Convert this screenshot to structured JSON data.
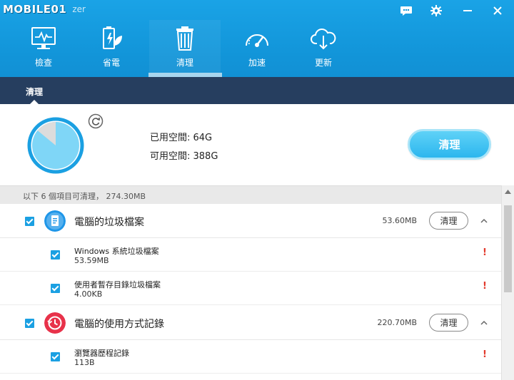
{
  "app": {
    "brand_logo": "MOBILE01",
    "brand_suffix": "zer"
  },
  "nav": {
    "items": [
      {
        "label": "檢查",
        "icon": "monitor-pulse-icon"
      },
      {
        "label": "省電",
        "icon": "battery-leaf-icon"
      },
      {
        "label": "清理",
        "icon": "trash-icon",
        "active": true
      },
      {
        "label": "加速",
        "icon": "speedometer-icon"
      },
      {
        "label": "更新",
        "icon": "cloud-download-icon"
      }
    ]
  },
  "subbar": {
    "tab": "清理"
  },
  "summary": {
    "used_label": "已用空間: 64G",
    "free_label": "可用空間: 388G",
    "used_fraction": 0.14,
    "clean_button": "清理"
  },
  "info": {
    "text": "以下 6 個項目可清理， 274.30MB"
  },
  "groups": [
    {
      "title": "電腦的垃圾檔案",
      "size": "53.60MB",
      "clean_label": "清理",
      "icon": "document-icon",
      "icon_color": "#1e96e8",
      "items": [
        {
          "name": "Windows 系統垃圾檔案",
          "size": "53.59MB",
          "warn": "!"
        },
        {
          "name": "使用者暫存目錄垃圾檔案",
          "size": "4.00KB",
          "warn": "!"
        }
      ]
    },
    {
      "title": "電腦的使用方式記錄",
      "size": "220.70MB",
      "clean_label": "清理",
      "icon": "history-clock-icon",
      "icon_color": "#e8324a",
      "items": [
        {
          "name": "瀏覽器歷程記錄",
          "size": "113B",
          "warn": "!"
        }
      ]
    }
  ],
  "colors": {
    "header": "#1397db",
    "subbar": "#263e5f",
    "accent": "#1ba0e2",
    "warning": "#e23a2c"
  }
}
